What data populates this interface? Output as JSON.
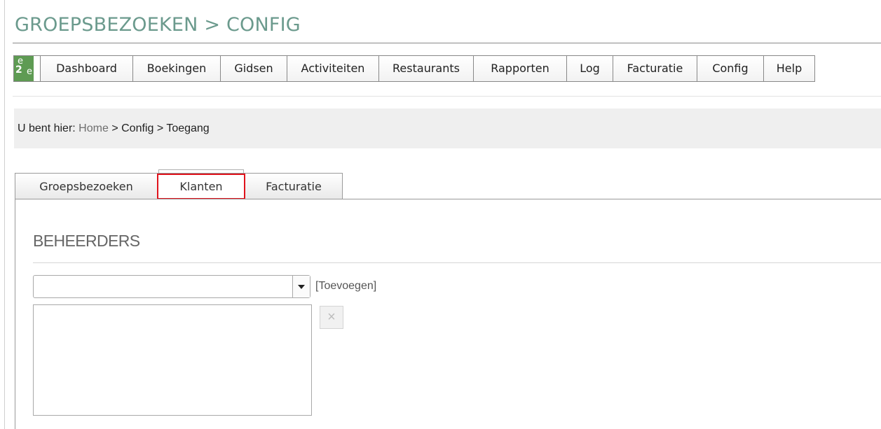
{
  "page": {
    "title": "GROEPSBEZOEKEN > CONFIG"
  },
  "logo": {
    "letters": [
      "e",
      "2",
      "e"
    ]
  },
  "nav": {
    "items": [
      {
        "label": "Dashboard",
        "name": "dashboard"
      },
      {
        "label": "Boekingen",
        "name": "boekingen"
      },
      {
        "label": "Gidsen",
        "name": "gidsen"
      },
      {
        "label": "Activiteiten",
        "name": "activiteiten"
      },
      {
        "label": "Restaurants",
        "name": "restaurants"
      },
      {
        "label": "Rapporten",
        "name": "rapporten"
      },
      {
        "label": "Log",
        "name": "log"
      },
      {
        "label": "Facturatie",
        "name": "facturatie"
      },
      {
        "label": "Config",
        "name": "config"
      },
      {
        "label": "Help",
        "name": "help"
      }
    ]
  },
  "breadcrumb": {
    "prefix": "U bent hier:",
    "home": "Home",
    "sep": ">",
    "config": "Config",
    "current": "Toegang"
  },
  "tabs": [
    {
      "label": "Groepsbezoeken",
      "active": false
    },
    {
      "label": "Klanten",
      "active": true
    },
    {
      "label": "Facturatie",
      "active": false
    }
  ],
  "section": {
    "title": "BEHEERDERS",
    "select": {
      "value": ""
    },
    "add_link": "[Toevoegen]",
    "remove_symbol": "×"
  },
  "colors": {
    "title": "#6b9a8d",
    "logo_bg": "#5e9b53",
    "highlight": "#e0131c"
  }
}
